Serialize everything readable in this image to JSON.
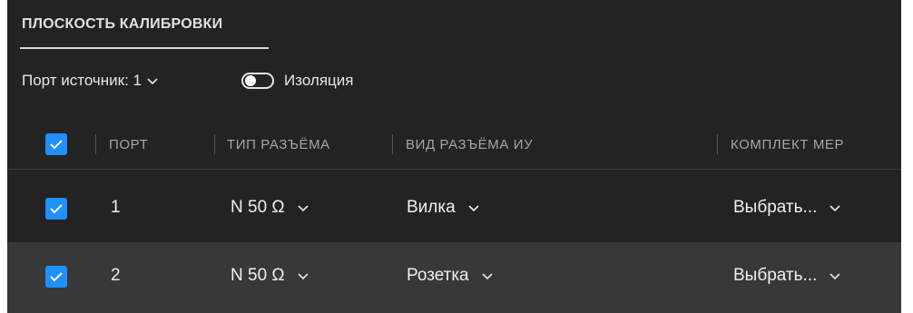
{
  "section": {
    "title": "ПЛОСКОСТЬ КАЛИБРОВКИ"
  },
  "port_source": {
    "label": "Порт источник: 1"
  },
  "isolation": {
    "label": "Изоляция",
    "enabled": false
  },
  "table": {
    "headers": {
      "port": "ПОРТ",
      "connector_type": "ТИП РАЗЪЁМА",
      "connector_gender": "ВИД РАЗЪЁМА ИУ",
      "cal_kit": "КОМПЛЕКТ МЕР"
    },
    "rows": [
      {
        "selected": true,
        "port": "1",
        "connector_type": "N 50 Ω",
        "connector_gender": "Вилка",
        "cal_kit": "Выбрать..."
      },
      {
        "selected": true,
        "port": "2",
        "connector_type": "N 50 Ω",
        "connector_gender": "Розетка",
        "cal_kit": "Выбрать..."
      }
    ]
  },
  "colors": {
    "background": "#232323",
    "alt_row": "#383838",
    "accent": "#1e90ff",
    "text": "#efefef",
    "header_text": "#a6a6a6"
  }
}
